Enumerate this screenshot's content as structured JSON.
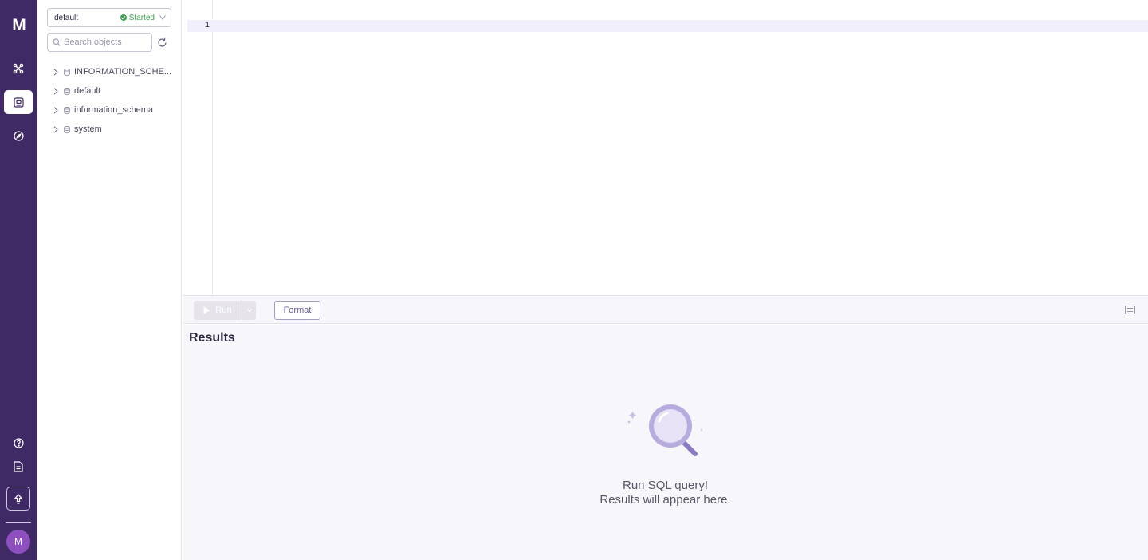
{
  "rail": {
    "logo_text": "M",
    "avatar_initial": "M",
    "icons": [
      "connect-icon",
      "sql-editor-icon",
      "compass-icon",
      "help-icon",
      "docs-icon",
      "upgrade-icon"
    ],
    "colors": {
      "background": "#3f2a66",
      "avatar": "#8e4fbf"
    }
  },
  "explorer": {
    "database": "default",
    "status": "Started",
    "search_placeholder": "Search objects",
    "tree": [
      {
        "label": "INFORMATION_SCHE..."
      },
      {
        "label": "default"
      },
      {
        "label": "information_schema"
      },
      {
        "label": "system"
      }
    ]
  },
  "editor": {
    "line_number": "1",
    "content": ""
  },
  "toolbar": {
    "run_label": "Run",
    "format_label": "Format"
  },
  "results": {
    "title": "Results",
    "empty_line1": "Run SQL query!",
    "empty_line2": "Results will appear here."
  }
}
